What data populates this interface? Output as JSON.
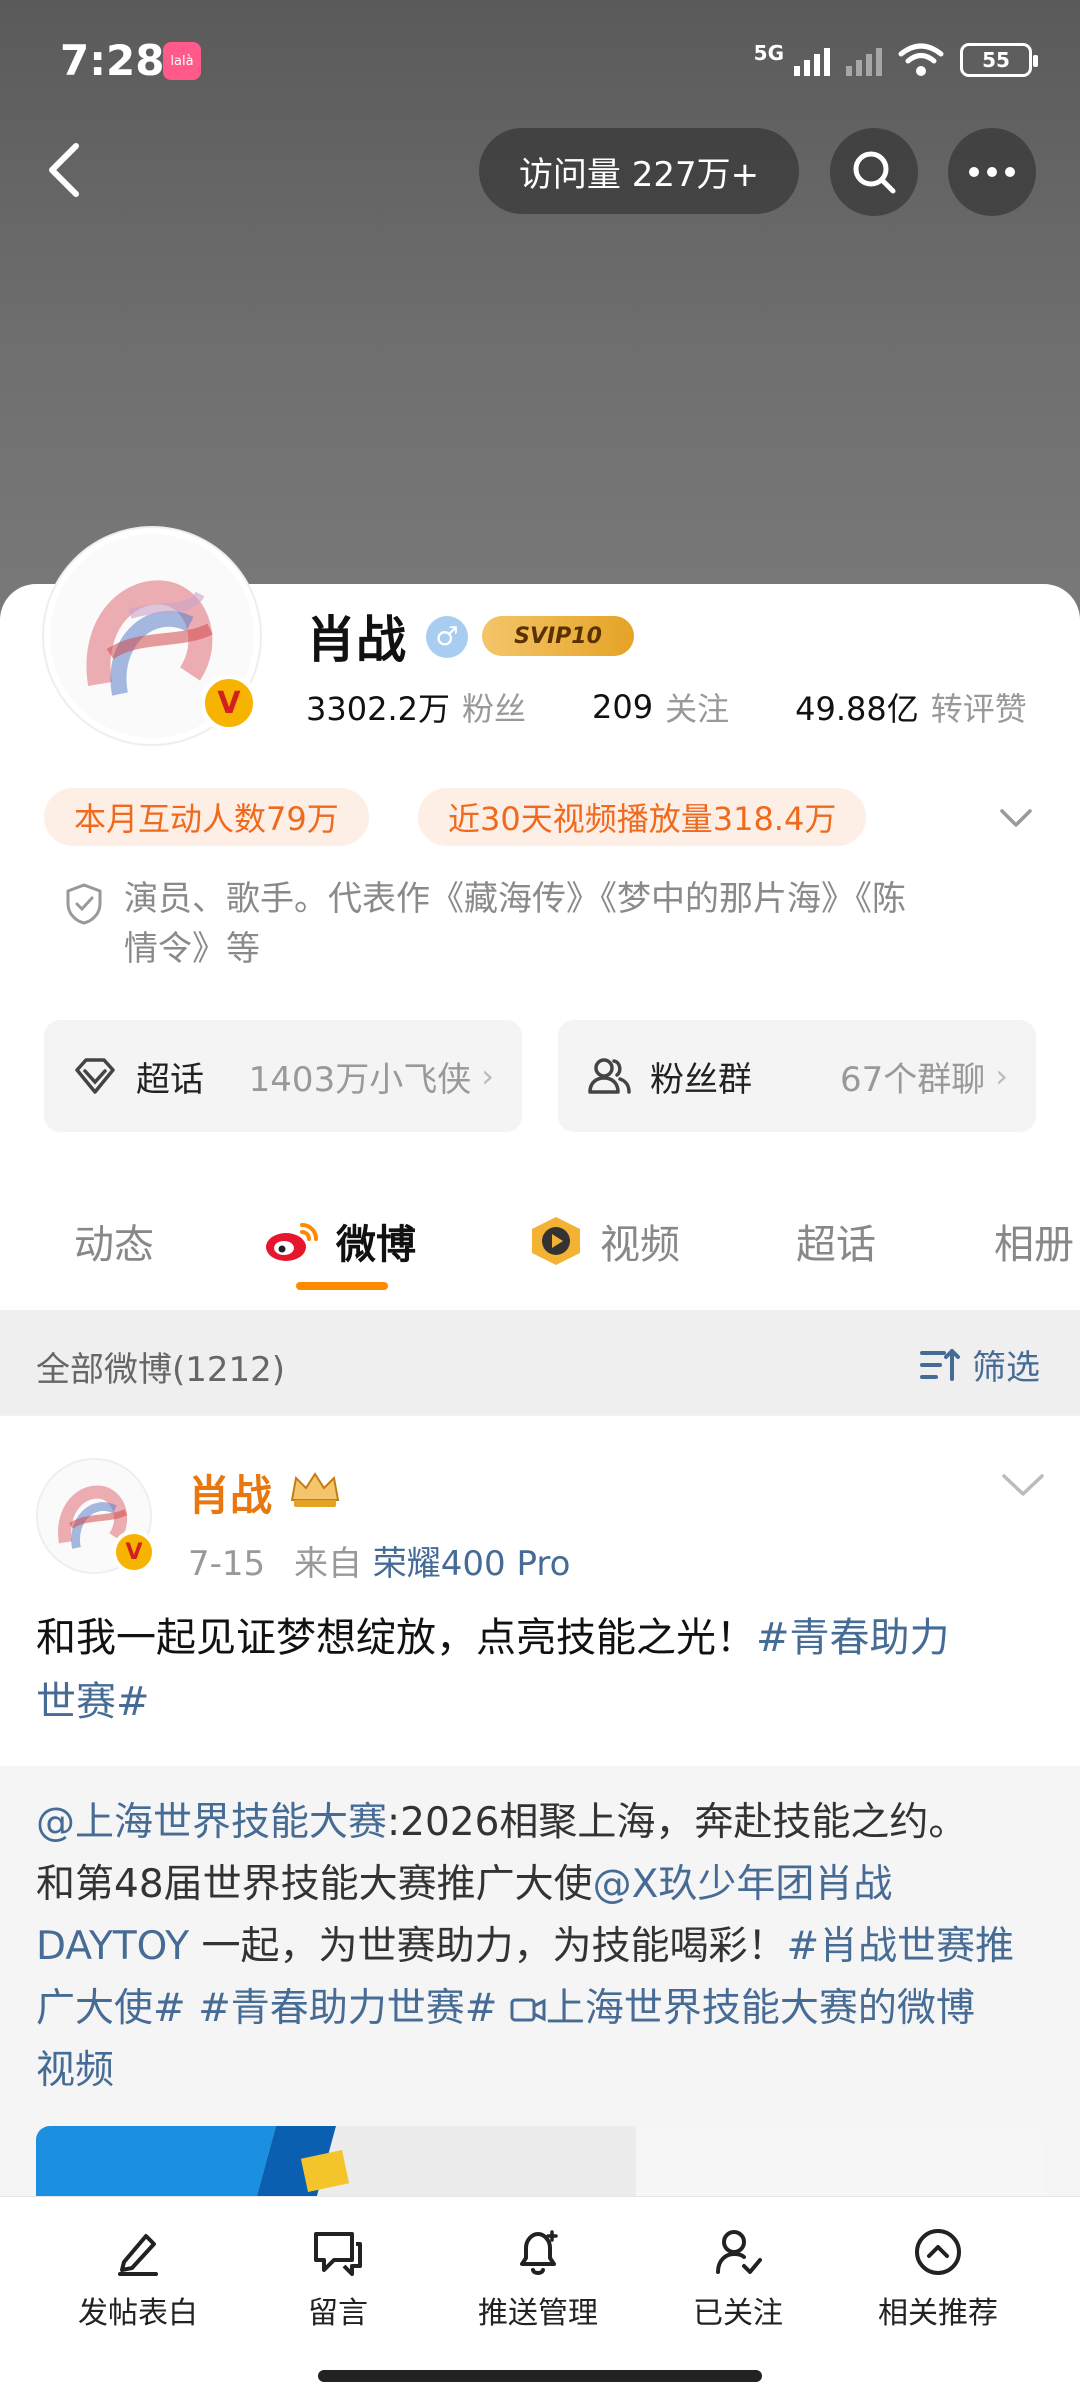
{
  "status": {
    "time": "7:28",
    "network": "5G",
    "battery": "55",
    "app_badge": "lalà"
  },
  "header": {
    "visits": "访问量 227万+"
  },
  "profile": {
    "name": "肖战",
    "gender_symbol": "♂",
    "svip": "SVIP10",
    "verified_badge": "V",
    "stats": {
      "fans_num": "3302.2万",
      "fans_label": "粉丝",
      "follow_num": "209",
      "follow_label": "关注",
      "likes_num": "49.88亿",
      "likes_label": "转评赞"
    },
    "tags": [
      "本月互动人数79万",
      "近30天视频播放量318.4万"
    ],
    "bio_line1": "演员、歌手。代表作《藏海传》《梦中的那片海》《陈",
    "bio_line2": "情令》等",
    "chips": {
      "supertopic_label": "超话",
      "supertopic_value": "1403万小飞侠",
      "fangroup_label": "粉丝群",
      "fangroup_value": "67个群聊",
      "arrow": "›"
    }
  },
  "tabs": [
    "动态",
    "微博",
    "视频",
    "超话",
    "相册"
  ],
  "filter": {
    "all": "全部微博(1212)",
    "filter": "筛选"
  },
  "post": {
    "author": "肖战",
    "date": "7-15",
    "from": "来自",
    "device": "荣耀400 Pro",
    "text_plain": "和我一起见证梦想绽放，点亮技能之光！",
    "text_tag_a": "#青春助力",
    "text_tag_b": "世赛#",
    "repost": {
      "mention": "@上海世界技能大赛",
      "line1_rest": ":2026相聚上海，奔赴技能之约。",
      "line2_plain": "和第48届世界技能大赛推广大使",
      "line2_mention": "@X玖少年团肖战",
      "line3_mention": "DAYTOY",
      "line3_plain": "一起，为世赛助力，为技能喝彩！",
      "line3_tag": "#肖战世赛推",
      "line4_tag1": "广大使#",
      "line4_tag2": "#青春助力世赛#",
      "line4_video": "上海世界技能大赛的微博",
      "line5_video": "视频"
    }
  },
  "bottom_nav": [
    "发帖表白",
    "留言",
    "推送管理",
    "已关注",
    "相关推荐"
  ],
  "colors": {
    "accent_orange": "#ff8a00",
    "link_blue": "#466b95",
    "tag_bg": "#fdeee6",
    "tag_text": "#f06a1e"
  }
}
